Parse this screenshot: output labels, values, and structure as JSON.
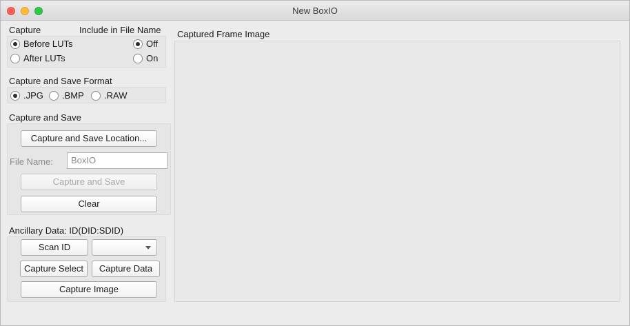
{
  "window": {
    "title": "New BoxIO"
  },
  "capture": {
    "header": "Capture",
    "before_luts": "Before LUTs",
    "after_luts": "After LUTs",
    "before_selected": true,
    "after_selected": false
  },
  "include_in_file_name": {
    "header": "Include in File Name",
    "off": "Off",
    "on": "On",
    "off_selected": true,
    "on_selected": false
  },
  "format": {
    "header": "Capture and Save Format",
    "options": [
      {
        "label": ".JPG",
        "selected": true
      },
      {
        "label": ".BMP",
        "selected": false
      },
      {
        "label": ".RAW",
        "selected": false
      }
    ]
  },
  "capture_save": {
    "header": "Capture and Save",
    "location_button": "Capture and Save Location...",
    "file_name_label": "File Name:",
    "file_name_value": "BoxIO",
    "capture_save_button": "Capture and Save",
    "clear_button": "Clear"
  },
  "ancillary": {
    "header": "Ancillary Data:  ID(DID:SDID)",
    "scan_id_button": "Scan ID",
    "id_select_value": "",
    "capture_select_button": "Capture Select",
    "capture_data_button": "Capture Data",
    "capture_image_button": "Capture Image"
  },
  "image_panel": {
    "label": "Captured Frame Image"
  },
  "colors": {
    "window_bg": "#ececec",
    "close": "#fc605c",
    "minimize": "#fdbc40",
    "maximize": "#34c84a"
  }
}
